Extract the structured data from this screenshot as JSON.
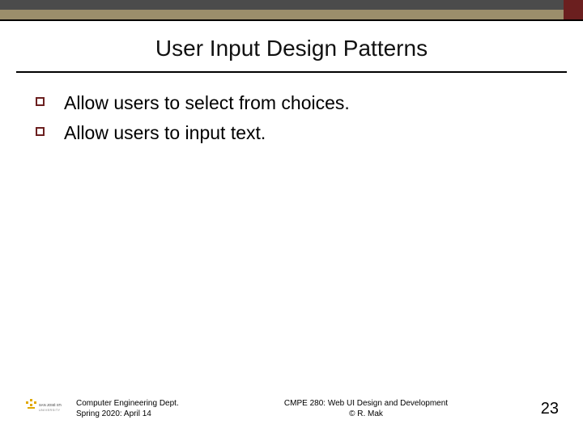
{
  "title": "User Input Design Patterns",
  "bullets": [
    "Allow users to select from choices.",
    "Allow users to input text."
  ],
  "footer": {
    "left_line1": "Computer Engineering Dept.",
    "left_line2": "Spring 2020: April 14",
    "center_line1": "CMPE 280: Web UI Design and Development",
    "center_line2": "© R. Mak",
    "page_number": "23"
  },
  "logo_text": "SAN JOSÉ STATE UNIVERSITY",
  "colors": {
    "accent_dark_red": "#6b1f1f",
    "bar_gray": "#4b4b4b",
    "bar_olive": "#9b8e6b"
  }
}
